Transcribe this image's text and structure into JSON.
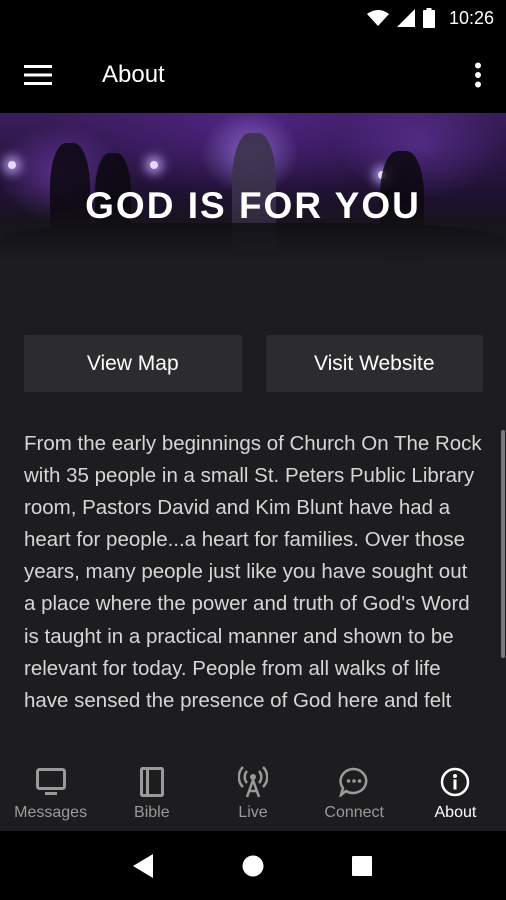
{
  "status_bar": {
    "time": "10:26",
    "icons": [
      "wifi-icon",
      "signal-icon",
      "battery-icon"
    ]
  },
  "app_bar": {
    "title": "About",
    "menu_icon": "hamburger-menu-icon",
    "overflow_icon": "more-vert-icon"
  },
  "hero": {
    "title": "GOD IS FOR YOU"
  },
  "actions": {
    "view_map": "View Map",
    "visit_website": "Visit Website"
  },
  "about": {
    "body": "From the early beginnings of Church On The Rock with 35 people in a small St. Peters Public Library room, Pastors David and Kim Blunt have had a heart for people...a heart for families. Over those years, many people just like you have sought out a place where the power and truth of God's Word is taught in a practical manner and shown to be relevant for today. People from all walks of life have sensed the presence of God here and felt"
  },
  "bottom_nav": {
    "items": [
      {
        "label": "Messages",
        "icon": "tv-icon",
        "active": false
      },
      {
        "label": "Bible",
        "icon": "book-icon",
        "active": false
      },
      {
        "label": "Live",
        "icon": "broadcast-icon",
        "active": false
      },
      {
        "label": "Connect",
        "icon": "chat-bubble-icon",
        "active": false
      },
      {
        "label": "About",
        "icon": "info-icon",
        "active": true
      }
    ]
  },
  "colors": {
    "app_bar": "#000000",
    "background": "#1d1d1f",
    "button": "#2c2c2e",
    "inactive_nav": "#9a9a9a",
    "text": "#d6d6d6"
  }
}
